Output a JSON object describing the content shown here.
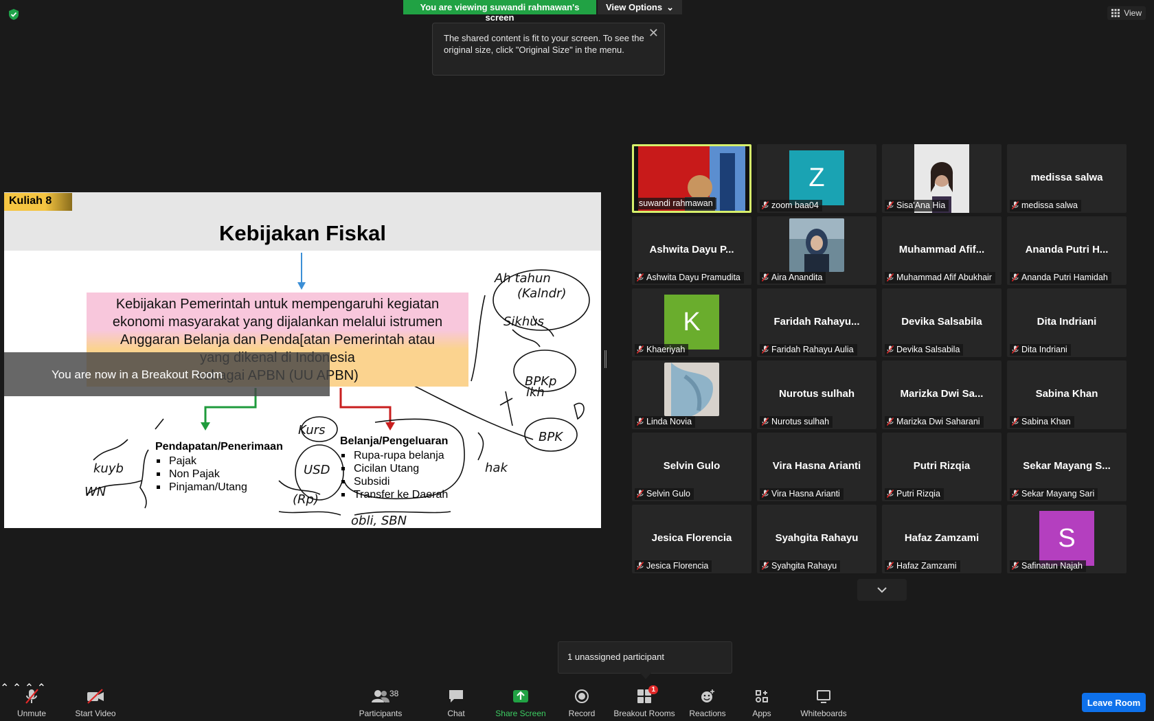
{
  "top": {
    "banner_text": "You are viewing suwandi rahmawan's screen",
    "view_options": "View Options",
    "tooltip_text": "The shared content is fit to your screen. To see the original size, click \"Original Size\" in the menu.",
    "view_label": "View"
  },
  "slide": {
    "tag": "Kuliah 8",
    "title": "Kebijakan Fiskal",
    "box_lines": [
      "Kebijakan Pemerintah untuk mempengaruhi kegiatan",
      "ekonomi masyarakat  yang dijalankan melalui istrumen",
      "Anggaran Belanja dan Penda[atan Pemerintah atau",
      "yang dikenal di Indonesia",
      "sebagai APBN (UU APBN)"
    ],
    "left_heading": "Pendapatan/Penerimaan",
    "left_items": [
      "Pajak",
      "Non Pajak",
      "Pinjaman/Utang"
    ],
    "right_heading": "Belanja/Pengeluaran",
    "right_items": [
      "Rupa-rupa belanja",
      "Cicilan Utang",
      "Subsidi",
      "Transfer ke Daerah"
    ]
  },
  "breakout_msg": "You are now in a Breakout Room",
  "participants": [
    {
      "name": "suwandi rahmawan",
      "display": "",
      "type": "video",
      "active": true
    },
    {
      "name": "zoom baa04",
      "display": "Z",
      "type": "avatar",
      "color": "#1aa3b3"
    },
    {
      "name": "Sisa'Ana Hia",
      "display": "",
      "type": "photo-girl"
    },
    {
      "name": "medissa salwa",
      "display": "medissa salwa",
      "type": "text"
    },
    {
      "name": "Ashwita Dayu Pramudita",
      "display": "Ashwita Dayu P...",
      "type": "text"
    },
    {
      "name": "Aira Anandita",
      "display": "",
      "type": "photo-hijab"
    },
    {
      "name": "Muhammad Afif Abukhair",
      "display": "Muhammad Afif...",
      "type": "text"
    },
    {
      "name": "Ananda Putri Hamidah",
      "display": "Ananda Putri H...",
      "type": "text"
    },
    {
      "name": "Khaeriyah",
      "display": "K",
      "type": "avatar",
      "color": "#6aad2d"
    },
    {
      "name": "Faridah Rahayu Aulia",
      "display": "Faridah Rahayu...",
      "type": "text"
    },
    {
      "name": "Devika Salsabila",
      "display": "Devika Salsabila",
      "type": "text"
    },
    {
      "name": "Dita Indriani",
      "display": "Dita Indriani",
      "type": "text"
    },
    {
      "name": "Linda Novia",
      "display": "",
      "type": "photo-scarf"
    },
    {
      "name": "Nurotus sulhah",
      "display": "Nurotus sulhah",
      "type": "text"
    },
    {
      "name": "Marizka Dwi Saharani",
      "display": "Marizka Dwi Sa...",
      "type": "text"
    },
    {
      "name": "Sabina Khan",
      "display": "Sabina Khan",
      "type": "text"
    },
    {
      "name": "Selvin Gulo",
      "display": "Selvin Gulo",
      "type": "text"
    },
    {
      "name": "Vira Hasna Arianti",
      "display": "Vira Hasna Arianti",
      "type": "text"
    },
    {
      "name": "Putri Rizqia",
      "display": "Putri Rizqia",
      "type": "text"
    },
    {
      "name": "Sekar Mayang Sari",
      "display": "Sekar Mayang S...",
      "type": "text"
    },
    {
      "name": "Jesica Florencia",
      "display": "Jesica Florencia",
      "type": "text"
    },
    {
      "name": "Syahgita Rahayu",
      "display": "Syahgita Rahayu",
      "type": "text"
    },
    {
      "name": "Hafaz Zamzami",
      "display": "Hafaz Zamzami",
      "type": "text"
    },
    {
      "name": "Safinatun Najah",
      "display": "S",
      "type": "avatar",
      "color": "#b43fbf"
    }
  ],
  "unassigned": "1 unassigned participant",
  "toolbar": {
    "unmute": "Unmute",
    "start_video": "Start Video",
    "participants": "Participants",
    "participants_count": "38",
    "chat": "Chat",
    "share_screen": "Share Screen",
    "record": "Record",
    "breakout_rooms": "Breakout Rooms",
    "breakout_badge": "1",
    "reactions": "Reactions",
    "apps": "Apps",
    "whiteboards": "Whiteboards",
    "leave": "Leave Room"
  },
  "colors": {
    "share_green": "#21a244",
    "leave_blue": "#0e71eb",
    "active_speaker": "#d7f06b",
    "muted_red": "#e02828"
  }
}
